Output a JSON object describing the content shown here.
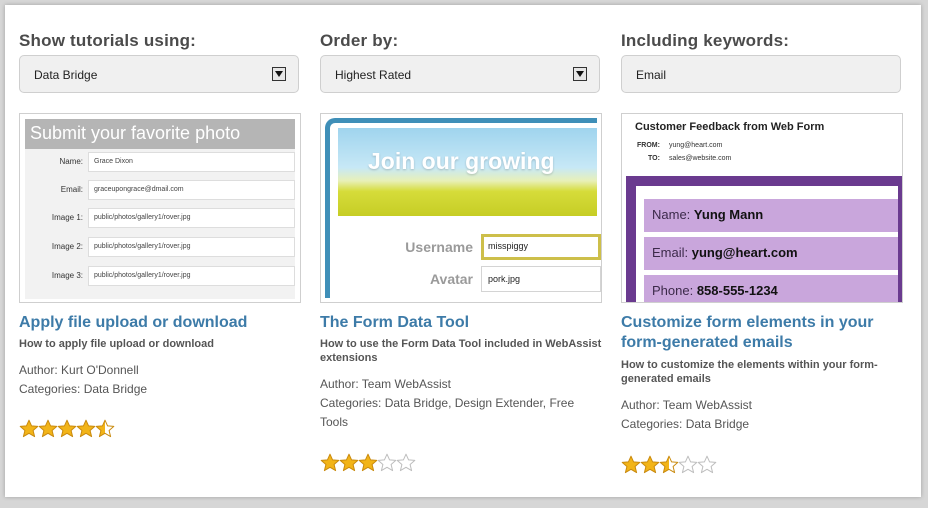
{
  "filters": {
    "show_label": "Show tutorials using:",
    "show_value": "Data Bridge",
    "order_label": "Order by:",
    "order_value": "Highest Rated",
    "keywords_label": "Including keywords:",
    "keywords_value": "Email"
  },
  "tutorials": [
    {
      "title": "Apply file upload or download",
      "subtitle": "How to apply file upload or download",
      "author": "Author: Kurt O'Donnell",
      "categories": "Categories: Data Bridge",
      "rating": 4.5,
      "thumb": {
        "heading": "Submit your favorite photo",
        "rows": [
          {
            "label": "Name:",
            "value": "Grace Dixon"
          },
          {
            "label": "Email:",
            "value": "graceupongrace@dmail.com"
          },
          {
            "label": "Image 1:",
            "value": "public/photos/gallery1/rover.jpg"
          },
          {
            "label": "Image 2:",
            "value": "public/photos/gallery1/rover.jpg"
          },
          {
            "label": "Image 3:",
            "value": "public/photos/gallery1/rover.jpg"
          }
        ]
      }
    },
    {
      "title": "The Form Data Tool",
      "subtitle": "How to use the Form Data Tool included in WebAssist extensions",
      "author": "Author: Team WebAssist",
      "categories": "Categories: Data Bridge, Design Extender, Free Tools",
      "rating": 3,
      "thumb": {
        "banner": "Join our growing",
        "username_label": "Username",
        "username_value": "misspiggy",
        "avatar_label": "Avatar",
        "avatar_value": "pork.jpg"
      }
    },
    {
      "title": "Customize form elements in your form-generated emails",
      "subtitle": "How to customize the elements within your form-generated emails",
      "author": "Author: Team WebAssist",
      "categories": "Categories: Data Bridge",
      "rating": 2.5,
      "thumb": {
        "heading": "Customer Feedback from Web Form",
        "from_label": "FROM:",
        "from_value": "yung@heart.com",
        "to_label": "TO:",
        "to_value": "sales@website.com",
        "name_label": "Name:",
        "name_value": "Yung Mann",
        "email_label": "Email:",
        "email_value": "yung@heart.com",
        "phone_label": "Phone:",
        "phone_value": "858-555-1234"
      }
    }
  ],
  "colors": {
    "title": "#3d7ba8",
    "star_fill": "#f2b418",
    "star_empty": "#ffffff"
  }
}
